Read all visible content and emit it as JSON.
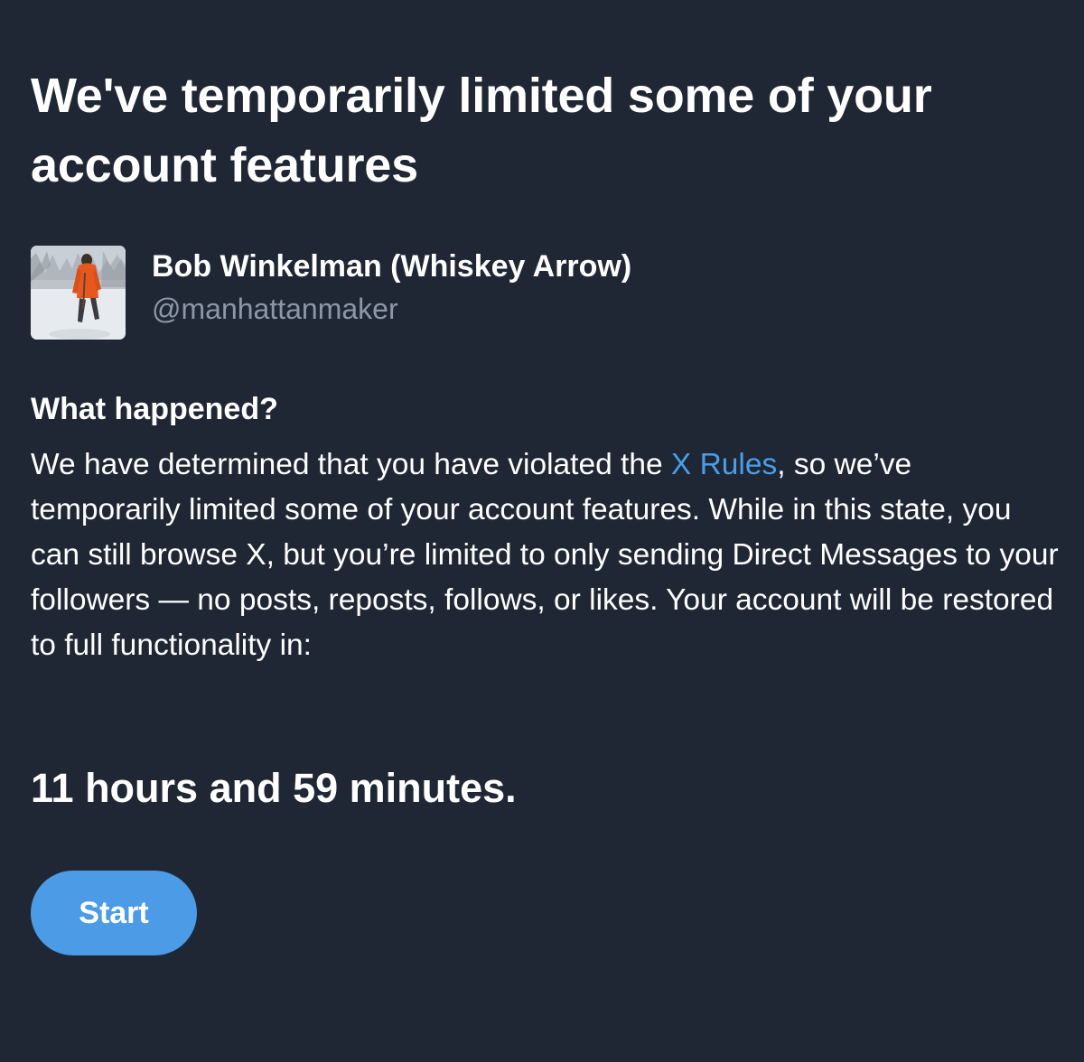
{
  "page": {
    "title": "We've temporarily limited some of your account features"
  },
  "profile": {
    "display_name": "Bob Winkelman (Whiskey Arrow)",
    "handle": "@manhattanmaker",
    "avatar_icon": "profile-photo"
  },
  "details": {
    "heading": "What happened?",
    "text_before_link": "We have determined that you have violated the ",
    "link_label": "X Rules",
    "text_after_link": ", so we’ve temporarily limited some of your account features. While in this state, you can still browse X, but you’re limited to only sending Direct Messages to your followers — no posts, reposts, follows, or likes. Your account will be restored to full functionality in:"
  },
  "countdown": {
    "text": "11 hours and 59 minutes."
  },
  "actions": {
    "start_label": "Start"
  },
  "colors": {
    "background": "#1f2735",
    "text": "#ffffff",
    "secondary_text": "#8b98a5",
    "link": "#4a9ee8",
    "button": "#4b9be6"
  }
}
